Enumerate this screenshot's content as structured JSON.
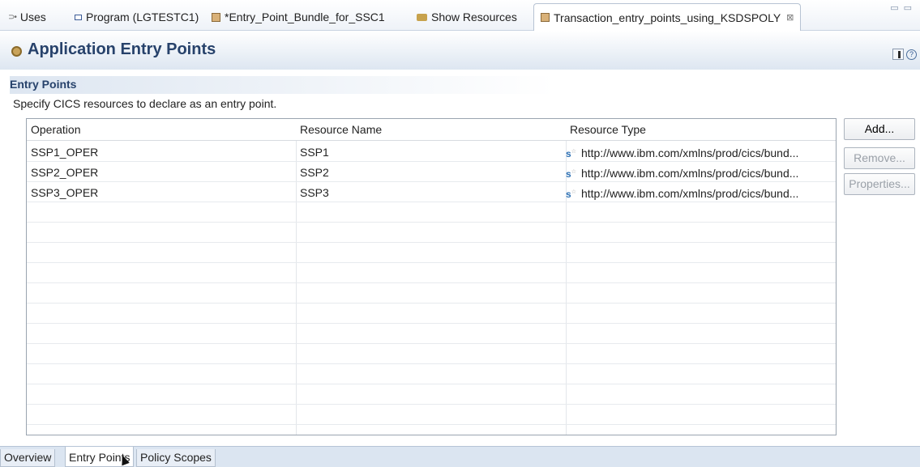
{
  "tabs": [
    {
      "label": "Uses",
      "icon": "uses-icon"
    },
    {
      "label": "Program (LGTESTC1)",
      "icon": "program-icon"
    },
    {
      "label": "*Entry_Point_Bundle_for_SSC1",
      "icon": "bundle-icon"
    },
    {
      "label": "Show Resources",
      "icon": "resources-icon"
    },
    {
      "label": "Transaction_entry_points_using_KSDSPOLY",
      "icon": "bundle-icon",
      "active": true,
      "close": "⊠"
    }
  ],
  "editor": {
    "title": "Application Entry Points"
  },
  "section": {
    "title": "Entry Points",
    "description": "Specify CICS resources to declare as an entry point."
  },
  "table": {
    "columns": [
      "Operation",
      "Resource Name",
      "Resource Type"
    ],
    "rows": [
      {
        "operation": "SSP1_OPER",
        "resource_name": "SSP1",
        "resource_type": "http://www.ibm.com/xmlns/prod/cics/bund..."
      },
      {
        "operation": "SSP2_OPER",
        "resource_name": "SSP2",
        "resource_type": "http://www.ibm.com/xmlns/prod/cics/bund..."
      },
      {
        "operation": "SSP3_OPER",
        "resource_name": "SSP3",
        "resource_type": "http://www.ibm.com/xmlns/prod/cics/bund..."
      }
    ]
  },
  "buttons": {
    "add": "Add...",
    "remove": "Remove...",
    "properties": "Properties..."
  },
  "bottom_tabs": [
    {
      "label": "Overview"
    },
    {
      "label": "Entry Points",
      "active": true
    },
    {
      "label": "Policy Scopes"
    }
  ],
  "colors": {
    "title": "#27426b",
    "header_bg": "#dde6f1",
    "link_icon": "#2b6fb3"
  }
}
